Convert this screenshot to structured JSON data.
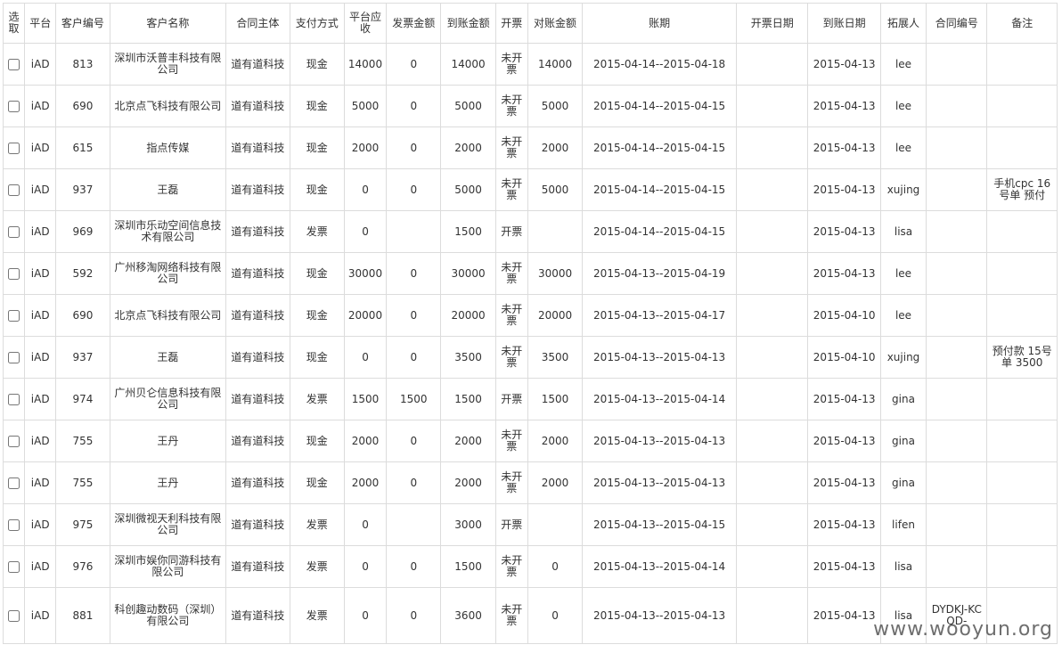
{
  "columns": [
    "选取",
    "平台",
    "客户编号",
    "客户名称",
    "合同主体",
    "支付方式",
    "平台应收",
    "发票金额",
    "到账金额",
    "开票",
    "对账金额",
    "账期",
    "开票日期",
    "到账日期",
    "拓展人",
    "合同编号",
    "备注"
  ],
  "rows": [
    {
      "platform": "iAD",
      "customer_id": "813",
      "customer_name": "深圳市沃普丰科技有限公司",
      "entity": "道有道科技",
      "payment": "现金",
      "receivable": "14000",
      "invoice_amount": "0",
      "received": "14000",
      "invoiced": "未开票",
      "reconciled": "14000",
      "period": "2015-04-14--2015-04-18",
      "invoice_date": "",
      "received_date": "2015-04-13",
      "owner": "lee",
      "contract_no": "",
      "remark": ""
    },
    {
      "platform": "iAD",
      "customer_id": "690",
      "customer_name": "北京点飞科技有限公司",
      "entity": "道有道科技",
      "payment": "现金",
      "receivable": "5000",
      "invoice_amount": "0",
      "received": "5000",
      "invoiced": "未开票",
      "reconciled": "5000",
      "period": "2015-04-14--2015-04-15",
      "invoice_date": "",
      "received_date": "2015-04-13",
      "owner": "lee",
      "contract_no": "",
      "remark": ""
    },
    {
      "platform": "iAD",
      "customer_id": "615",
      "customer_name": "指点传媒",
      "entity": "道有道科技",
      "payment": "现金",
      "receivable": "2000",
      "invoice_amount": "0",
      "received": "2000",
      "invoiced": "未开票",
      "reconciled": "2000",
      "period": "2015-04-14--2015-04-15",
      "invoice_date": "",
      "received_date": "2015-04-13",
      "owner": "lee",
      "contract_no": "",
      "remark": ""
    },
    {
      "platform": "iAD",
      "customer_id": "937",
      "customer_name": "王磊",
      "entity": "道有道科技",
      "payment": "现金",
      "receivable": "0",
      "invoice_amount": "0",
      "received": "5000",
      "invoiced": "未开票",
      "reconciled": "5000",
      "period": "2015-04-14--2015-04-15",
      "invoice_date": "",
      "received_date": "2015-04-13",
      "owner": "xujing",
      "contract_no": "",
      "remark": "手机cpc 16号单 预付"
    },
    {
      "platform": "iAD",
      "customer_id": "969",
      "customer_name": "深圳市乐动空间信息技术有限公司",
      "entity": "道有道科技",
      "payment": "发票",
      "receivable": "0",
      "invoice_amount": "",
      "received": "1500",
      "invoiced": "开票",
      "reconciled": "",
      "period": "2015-04-14--2015-04-15",
      "invoice_date": "",
      "received_date": "2015-04-13",
      "owner": "lisa",
      "contract_no": "",
      "remark": ""
    },
    {
      "platform": "iAD",
      "customer_id": "592",
      "customer_name": "广州移淘网络科技有限公司",
      "entity": "道有道科技",
      "payment": "现金",
      "receivable": "30000",
      "invoice_amount": "0",
      "received": "30000",
      "invoiced": "未开票",
      "reconciled": "30000",
      "period": "2015-04-13--2015-04-19",
      "invoice_date": "",
      "received_date": "2015-04-13",
      "owner": "lee",
      "contract_no": "",
      "remark": ""
    },
    {
      "platform": "iAD",
      "customer_id": "690",
      "customer_name": "北京点飞科技有限公司",
      "entity": "道有道科技",
      "payment": "现金",
      "receivable": "20000",
      "invoice_amount": "0",
      "received": "20000",
      "invoiced": "未开票",
      "reconciled": "20000",
      "period": "2015-04-13--2015-04-17",
      "invoice_date": "",
      "received_date": "2015-04-10",
      "owner": "lee",
      "contract_no": "",
      "remark": ""
    },
    {
      "platform": "iAD",
      "customer_id": "937",
      "customer_name": "王磊",
      "entity": "道有道科技",
      "payment": "现金",
      "receivable": "0",
      "invoice_amount": "0",
      "received": "3500",
      "invoiced": "未开票",
      "reconciled": "3500",
      "period": "2015-04-13--2015-04-13",
      "invoice_date": "",
      "received_date": "2015-04-10",
      "owner": "xujing",
      "contract_no": "",
      "remark": "预付款 15号单 3500"
    },
    {
      "platform": "iAD",
      "customer_id": "974",
      "customer_name": "广州贝仑信息科技有限公司",
      "entity": "道有道科技",
      "payment": "发票",
      "receivable": "1500",
      "invoice_amount": "1500",
      "received": "1500",
      "invoiced": "开票",
      "reconciled": "1500",
      "period": "2015-04-13--2015-04-14",
      "invoice_date": "",
      "received_date": "2015-04-13",
      "owner": "gina",
      "contract_no": "",
      "remark": ""
    },
    {
      "platform": "iAD",
      "customer_id": "755",
      "customer_name": "王丹",
      "entity": "道有道科技",
      "payment": "现金",
      "receivable": "2000",
      "invoice_amount": "0",
      "received": "2000",
      "invoiced": "未开票",
      "reconciled": "2000",
      "period": "2015-04-13--2015-04-13",
      "invoice_date": "",
      "received_date": "2015-04-13",
      "owner": "gina",
      "contract_no": "",
      "remark": ""
    },
    {
      "platform": "iAD",
      "customer_id": "755",
      "customer_name": "王丹",
      "entity": "道有道科技",
      "payment": "现金",
      "receivable": "2000",
      "invoice_amount": "0",
      "received": "2000",
      "invoiced": "未开票",
      "reconciled": "2000",
      "period": "2015-04-13--2015-04-13",
      "invoice_date": "",
      "received_date": "2015-04-13",
      "owner": "gina",
      "contract_no": "",
      "remark": ""
    },
    {
      "platform": "iAD",
      "customer_id": "975",
      "customer_name": "深圳微视天利科技有限公司",
      "entity": "道有道科技",
      "payment": "发票",
      "receivable": "0",
      "invoice_amount": "",
      "received": "3000",
      "invoiced": "开票",
      "reconciled": "",
      "period": "2015-04-13--2015-04-15",
      "invoice_date": "",
      "received_date": "2015-04-13",
      "owner": "lifen",
      "contract_no": "",
      "remark": ""
    },
    {
      "platform": "iAD",
      "customer_id": "976",
      "customer_name": "深圳市娱你同游科技有限公司",
      "entity": "道有道科技",
      "payment": "发票",
      "receivable": "0",
      "invoice_amount": "0",
      "received": "1500",
      "invoiced": "未开票",
      "reconciled": "0",
      "period": "2015-04-13--2015-04-14",
      "invoice_date": "",
      "received_date": "2015-04-13",
      "owner": "lisa",
      "contract_no": "",
      "remark": ""
    },
    {
      "platform": "iAD",
      "customer_id": "881",
      "customer_name": "科创趣动数码（深圳）有限公司",
      "entity": "道有道科技",
      "payment": "发票",
      "receivable": "0",
      "invoice_amount": "0",
      "received": "3600",
      "invoiced": "未开票",
      "reconciled": "0",
      "period": "2015-04-13--2015-04-13",
      "invoice_date": "",
      "received_date": "2015-04-13",
      "owner": "lisa",
      "contract_no": "DYDKJ-KCQD-",
      "remark": ""
    }
  ],
  "watermark": "www.wooyun.org"
}
